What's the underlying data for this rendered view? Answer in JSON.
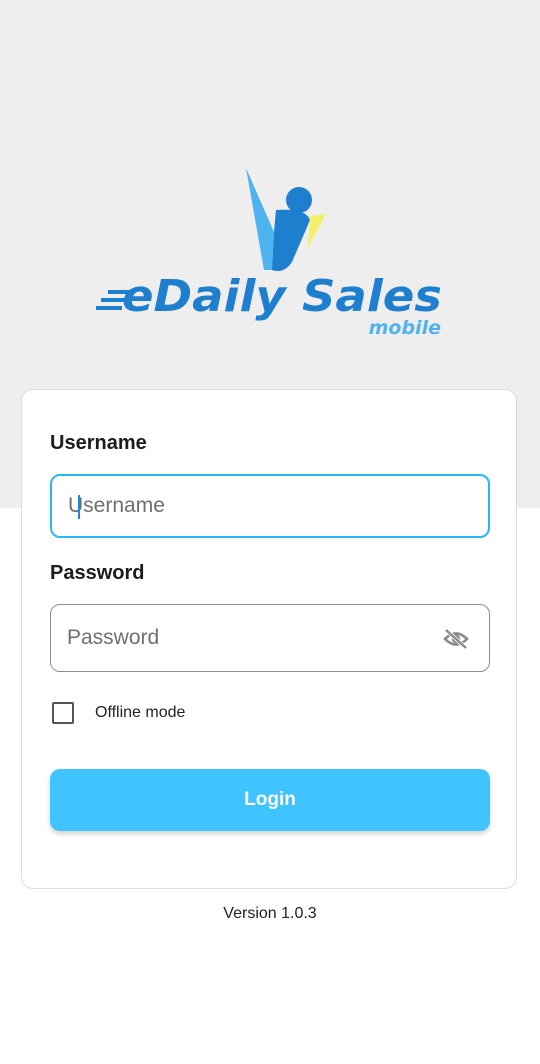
{
  "brand": {
    "name": "eDaily Sales",
    "subtitle": "mobile",
    "logo_icon": "person-raising-arm-icon",
    "colors": {
      "primary_blue": "#1e7fcf",
      "light_blue": "#4fb3f0",
      "yellow": "#f5ef6a"
    }
  },
  "form": {
    "username": {
      "label": "Username",
      "placeholder": "Username",
      "value": ""
    },
    "password": {
      "label": "Password",
      "placeholder": "Password",
      "value": "",
      "visibility_icon": "eye-off-icon"
    },
    "offline_mode": {
      "label": "Offline mode",
      "checked": false
    },
    "login_label": "Login"
  },
  "footer": {
    "version": "Version 1.0.3"
  },
  "colors": {
    "background_top": "#eeeeee",
    "focus_border": "#29b6f6",
    "button": "#40c4ff"
  }
}
